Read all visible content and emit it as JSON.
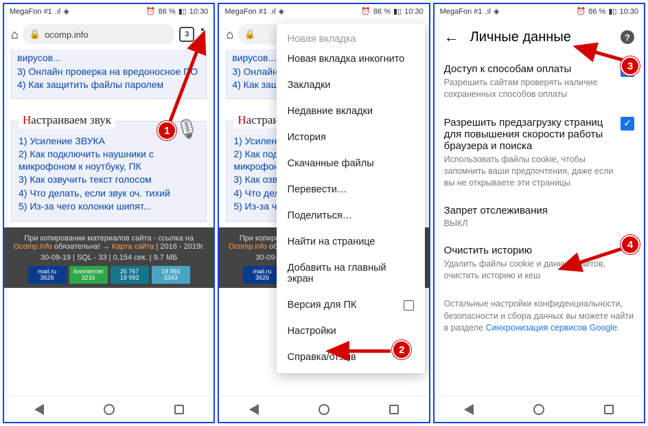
{
  "statusbar": {
    "carrier": "MegaFon #1",
    "battery_pct": "86 %",
    "time": "10:30",
    "alarm_icon": "⏰",
    "signal_icon": "📶",
    "wifi_icon": "📡",
    "bt_icon": "ᛒ",
    "batt_icon": "▮▯"
  },
  "chrome": {
    "url": "ocomp.info",
    "tabs": "3",
    "lock_icon": "🔒"
  },
  "page1": {
    "top_links": [
      "вирусов...",
      "3) Онлайн проверка на вредоносное ПО",
      "4) Как защитить файлы паролем"
    ],
    "section_title_first": "Н",
    "section_title_rest": "астраиваем звук",
    "mic_icon": "🎙",
    "sound_links": [
      "1) Усиление ЗВУКА",
      "2) Как подключить наушники с микрофоном к ноутбуку, ПК",
      "3) Как озвучить текст голосом",
      "4) Что делать, если звук оч. тихий",
      "5) Из-за чего колонки шипят..."
    ],
    "footer_line1_a": "При копировании материалов сайта - ссылка на ",
    "footer_ocomp": "Ocomp.info",
    "footer_mid": " обязательна!  → ",
    "footer_map": "Карта сайта",
    "footer_years": " | 2016 - 2019г.",
    "footer_line2": "30-09-19 | SQL - 33 | 0,154 сек. | 9.7 МБ",
    "badges": {
      "mail_top": "mail.ru",
      "mail_bot": "3626",
      "li_top": "liveinternet",
      "li_bot": "3216",
      "li2_top": "25 767",
      "li2_bot": "19 993",
      "li3_top": "19 993",
      "li3_bot": "3343"
    }
  },
  "menu": {
    "items": [
      "Новая вкладка",
      "Новая вкладка инкогнито",
      "Закладки",
      "Недавние вкладки",
      "История",
      "Скачанные файлы",
      "Перевести…",
      "Поделиться…",
      "Найти на странице",
      "Добавить на главный экран",
      "Версия для ПК",
      "Настройки",
      "Справка/отзыв"
    ]
  },
  "settings": {
    "back_icon": "←",
    "title": "Личные данные",
    "help_icon": "?",
    "payment_title": "Доступ к способам оплаты",
    "payment_desc": "Разрешить сайтам проверять наличие сохраненных способов оплаты",
    "preload_title": "Разрешить предзагрузку страниц для повышения скорости работы браузера и поиска",
    "preload_desc": "Использовать файлы cookie, чтобы запомнить ваши предпочтения, даже если вы не открываете эти страницы",
    "dnt_title": "Запрет отслеживания",
    "dnt_value": "ВЫКЛ",
    "clear_title": "Очистить историю",
    "clear_desc": "Удалить файлы cookie и данные сайтов, очистить историю и кеш",
    "note_a": "Остальные настройки конфиденциальности, безопасности и сбора данных вы можете найти в разделе ",
    "note_link": "Синхронизация сервисов Google",
    "check_mark": "✓"
  },
  "callouts": {
    "c1": "1",
    "c2": "2",
    "c3": "3",
    "c4": "4"
  }
}
